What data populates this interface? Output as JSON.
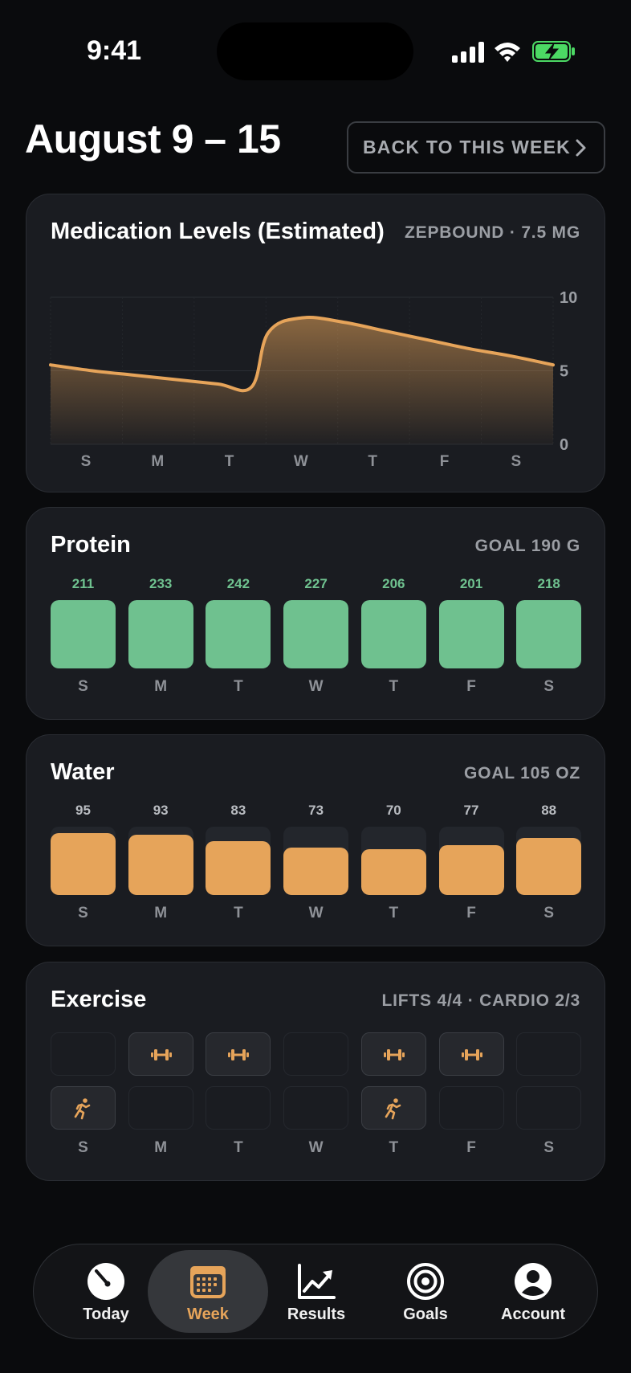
{
  "status_bar": {
    "time": "9:41"
  },
  "header": {
    "title": "August 9 – 15",
    "back_label": "BACK TO THIS WEEK"
  },
  "colors": {
    "accent": "#e6a45a",
    "protein": "#6fc18f",
    "background": "#0a0b0d",
    "card": "#1a1c21"
  },
  "medication": {
    "title": "Medication Levels (Estimated)",
    "meta": "ZEPBOUND · 7.5 MG",
    "chart_data": {
      "type": "area",
      "title": "Medication Levels (Estimated)",
      "categories": [
        "S",
        "M",
        "T",
        "W",
        "T",
        "F",
        "S"
      ],
      "x": [
        0,
        0.5,
        1,
        1.5,
        2,
        2.4,
        2.6,
        3,
        3.5,
        4,
        4.5,
        5,
        5.5,
        6
      ],
      "values": [
        5.4,
        5.0,
        4.7,
        4.4,
        4.1,
        3.9,
        7.6,
        8.6,
        8.3,
        7.7,
        7.1,
        6.5,
        6.0,
        5.4
      ],
      "ylim": [
        0,
        10
      ],
      "yticks": [
        "10",
        "5",
        "0"
      ],
      "grid": true
    }
  },
  "protein": {
    "title": "Protein",
    "meta": "GOAL 190 G",
    "days": [
      "S",
      "M",
      "T",
      "W",
      "T",
      "F",
      "S"
    ],
    "values": [
      "211",
      "233",
      "242",
      "227",
      "206",
      "201",
      "218"
    ],
    "goal": 190
  },
  "water": {
    "title": "Water",
    "meta": "GOAL 105 OZ",
    "days": [
      "S",
      "M",
      "T",
      "W",
      "T",
      "F",
      "S"
    ],
    "values": [
      "95",
      "93",
      "83",
      "73",
      "70",
      "77",
      "88"
    ],
    "goal": 105
  },
  "exercise": {
    "title": "Exercise",
    "meta": "LIFTS 4/4 · CARDIO 2/3",
    "days": [
      "S",
      "M",
      "T",
      "W",
      "T",
      "F",
      "S"
    ],
    "lifts": [
      false,
      true,
      true,
      false,
      true,
      true,
      false
    ],
    "cardio": [
      true,
      false,
      false,
      false,
      true,
      false,
      false
    ],
    "lift_icon": "dumbbell-icon",
    "cardio_icon": "running-icon"
  },
  "tabs": [
    {
      "label": "Today",
      "icon": "gauge-icon",
      "active": false
    },
    {
      "label": "Week",
      "icon": "calendar-icon",
      "active": true
    },
    {
      "label": "Results",
      "icon": "trend-chart-icon",
      "active": false
    },
    {
      "label": "Goals",
      "icon": "target-icon",
      "active": false
    },
    {
      "label": "Account",
      "icon": "person-icon",
      "active": false
    }
  ]
}
